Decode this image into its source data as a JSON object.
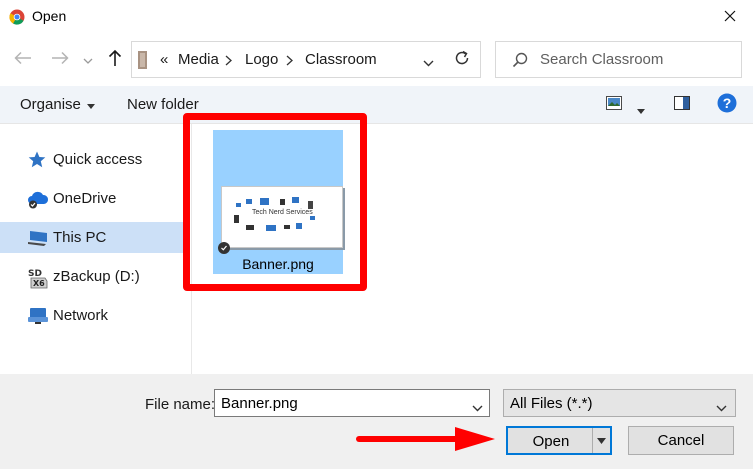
{
  "window": {
    "title": "Open"
  },
  "address": {
    "overflow": "«",
    "segments": [
      "Media",
      "Logo",
      "Classroom"
    ]
  },
  "search": {
    "placeholder": "Search Classroom"
  },
  "toolbar": {
    "organise_label": "Organise",
    "new_folder_label": "New folder"
  },
  "nav": {
    "items": [
      {
        "label": "Quick access",
        "icon": "star-icon",
        "selected": false
      },
      {
        "label": "OneDrive",
        "icon": "cloud-icon",
        "selected": false
      },
      {
        "label": "This PC",
        "icon": "computer-icon",
        "selected": true
      },
      {
        "label": "zBackup (D:)",
        "icon": "sd-card-icon",
        "selected": false
      },
      {
        "label": "Network",
        "icon": "network-icon",
        "selected": false
      }
    ]
  },
  "files": [
    {
      "name": "Banner.png",
      "thumbnail_text": "Tech Nerd Services",
      "selected": true
    }
  ],
  "bottom": {
    "filename_label": "File name:",
    "filename_value": "Banner.png",
    "filter_value": "All Files (*.*)",
    "open_label": "Open",
    "cancel_label": "Cancel"
  },
  "colors": {
    "accent": "#0078d7",
    "selection": "#cce0f7",
    "file_selected": "#99d1ff",
    "annotation_red": "#ff0000",
    "help_blue": "#1e6fd9"
  }
}
